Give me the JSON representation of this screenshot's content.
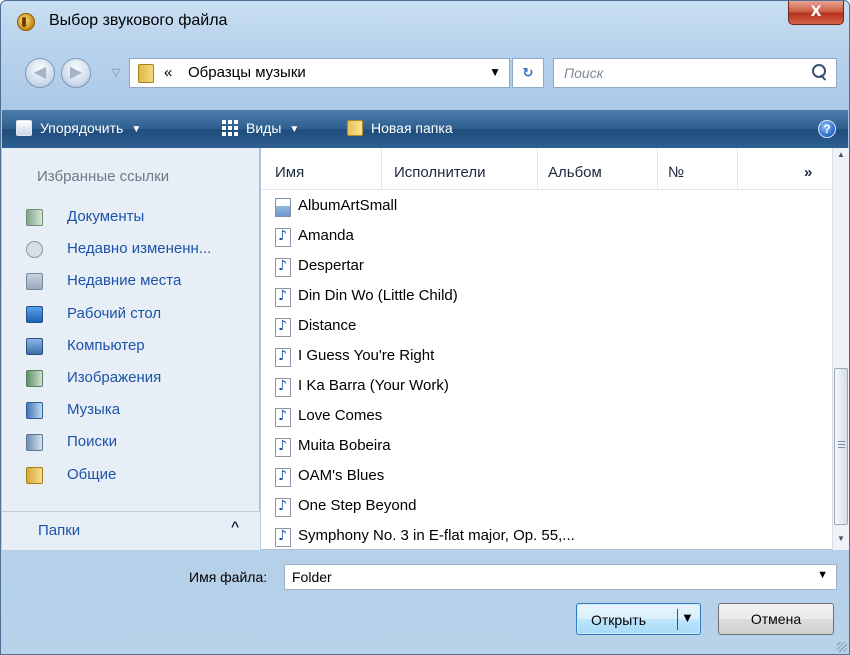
{
  "window": {
    "title": "Выбор звукового файла",
    "close_label": "X"
  },
  "address": {
    "chevron": "«",
    "path": "Образцы музыки",
    "dropdown": "▼",
    "refresh": "↻",
    "search_placeholder": "Поиск"
  },
  "toolbar": {
    "organize": "Упорядочить",
    "views": "Виды",
    "new_folder": "Новая папка",
    "help": "?",
    "caret": "▼"
  },
  "nav": {
    "header": "Избранные ссылки",
    "items": [
      {
        "label": "Документы",
        "icon": "documents-icon"
      },
      {
        "label": "Недавно измененн...",
        "icon": "recent-icon"
      },
      {
        "label": "Недавние места",
        "icon": "recent-places-icon"
      },
      {
        "label": "Рабочий стол",
        "icon": "desktop-icon"
      },
      {
        "label": "Компьютер",
        "icon": "computer-icon"
      },
      {
        "label": "Изображения",
        "icon": "pictures-icon"
      },
      {
        "label": "Музыка",
        "icon": "music-icon"
      },
      {
        "label": "Поиски",
        "icon": "searches-icon"
      },
      {
        "label": "Общие",
        "icon": "public-folder-icon"
      }
    ],
    "folders_label": "Папки",
    "folders_toggle": "^"
  },
  "columns": {
    "name": "Имя",
    "artists": "Исполнители",
    "album": "Альбом",
    "number": "№",
    "more": "»"
  },
  "files": [
    {
      "name": "AlbumArtSmall",
      "type": "image"
    },
    {
      "name": "Amanda",
      "type": "audio"
    },
    {
      "name": "Despertar",
      "type": "audio"
    },
    {
      "name": "Din Din Wo (Little Child)",
      "type": "audio"
    },
    {
      "name": "Distance",
      "type": "audio"
    },
    {
      "name": "I Guess You're Right",
      "type": "audio"
    },
    {
      "name": "I Ka Barra (Your Work)",
      "type": "audio"
    },
    {
      "name": "Love Comes",
      "type": "audio"
    },
    {
      "name": "Muita Bobeira",
      "type": "audio"
    },
    {
      "name": "OAM's Blues",
      "type": "audio"
    },
    {
      "name": "One Step Beyond",
      "type": "audio"
    },
    {
      "name": "Symphony No. 3 in E-flat major, Op. 55,...",
      "type": "audio"
    }
  ],
  "footer": {
    "filename_label": "Имя файла:",
    "filename_value": "Folder",
    "dropdown": "▼",
    "open_label": "Открыть",
    "open_arrow": "▼",
    "cancel_label": "Отмена"
  }
}
